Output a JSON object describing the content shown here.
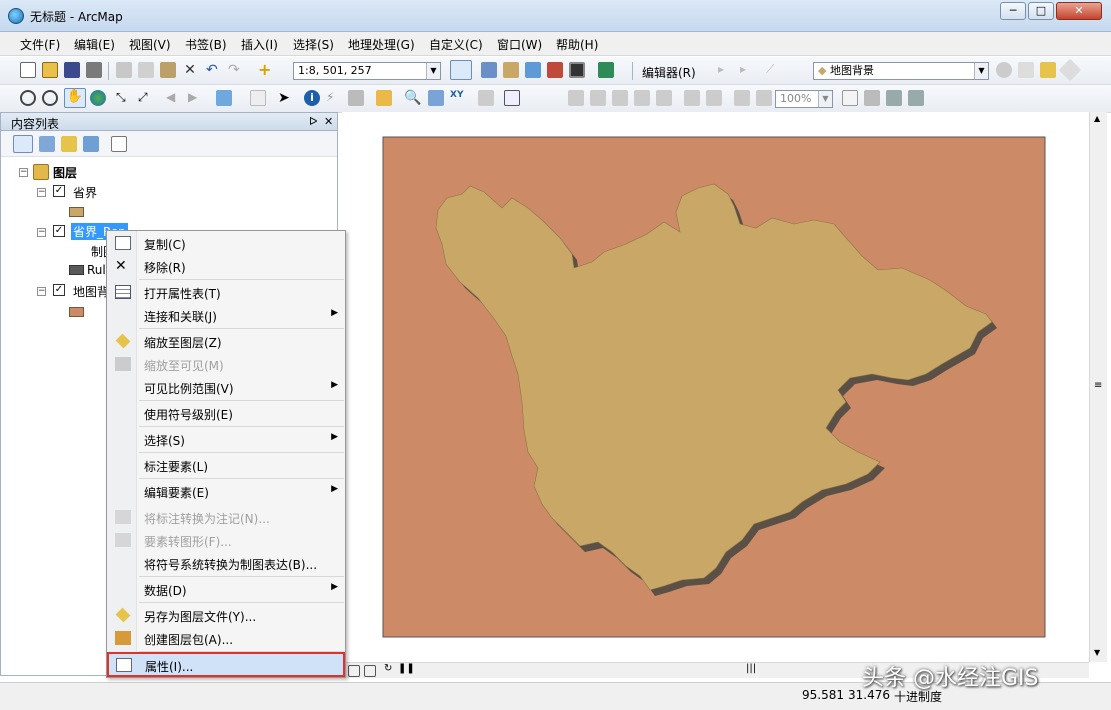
{
  "window": {
    "title": "无标题 - ArcMap",
    "minimize": "─",
    "maximize": "□",
    "close": "✕"
  },
  "menubar": [
    "文件(F)",
    "编辑(E)",
    "视图(V)",
    "书签(B)",
    "插入(I)",
    "选择(S)",
    "地理处理(G)",
    "自定义(C)",
    "窗口(W)",
    "帮助(H)"
  ],
  "toolbar": {
    "scale": "1:8, 501, 257",
    "editor_label": "编辑器(R)",
    "layer_combo": "地图背景",
    "zoom_percent": "100%"
  },
  "toc": {
    "title": "内容列表",
    "pin": "ᐅ",
    "close": "✕",
    "root": "图层",
    "layers": [
      {
        "name": "省界",
        "checked": true,
        "swatch": "#c9a767"
      },
      {
        "name": "省界_Rep",
        "checked": true,
        "child": "制图",
        "rule": "Rule"
      },
      {
        "name": "地图背景",
        "checked": true,
        "swatch": "#cd8a66"
      }
    ]
  },
  "context_menu": {
    "items": [
      {
        "label": "复制(C)",
        "icon": "copy-icon",
        "enabled": true
      },
      {
        "label": "移除(R)",
        "icon": "remove-icon",
        "enabled": true
      },
      {
        "label": "打开属性表(T)",
        "icon": "table-icon",
        "enabled": true
      },
      {
        "label": "连接和关联(J)",
        "icon": "",
        "enabled": true,
        "submenu": true
      },
      {
        "label": "缩放至图层(Z)",
        "icon": "zoom-layer-icon",
        "enabled": true
      },
      {
        "label": "缩放至可见(M)",
        "icon": "zoom-visible-icon",
        "enabled": false
      },
      {
        "label": "可见比例范围(V)",
        "icon": "",
        "enabled": true,
        "submenu": true
      },
      {
        "label": "使用符号级别(E)",
        "icon": "",
        "enabled": true
      },
      {
        "label": "选择(S)",
        "icon": "",
        "enabled": true,
        "submenu": true
      },
      {
        "label": "标注要素(L)",
        "icon": "",
        "enabled": true
      },
      {
        "label": "编辑要素(E)",
        "icon": "",
        "enabled": true,
        "submenu": true
      },
      {
        "label": "将标注转换为注记(N)...",
        "icon": "convert-label-icon",
        "enabled": false
      },
      {
        "label": "要素转图形(F)...",
        "icon": "feature-graphic-icon",
        "enabled": false
      },
      {
        "label": "将符号系统转换为制图表达(B)...",
        "icon": "",
        "enabled": true
      },
      {
        "label": "数据(D)",
        "icon": "",
        "enabled": true,
        "submenu": true
      },
      {
        "label": "另存为图层文件(Y)...",
        "icon": "save-layer-icon",
        "enabled": true
      },
      {
        "label": "创建图层包(A)...",
        "icon": "layer-package-icon",
        "enabled": true
      },
      {
        "label": "属性(I)...",
        "icon": "properties-icon",
        "enabled": true,
        "highlighted": true
      }
    ]
  },
  "map": {
    "background_color": "#cd8a66",
    "land_color": "#c9a767",
    "shadow_color": "#5a5046"
  },
  "status": {
    "x": "95.581",
    "y": "31.476",
    "units": "十进制度"
  },
  "watermark": "头条 @水经注GIS"
}
